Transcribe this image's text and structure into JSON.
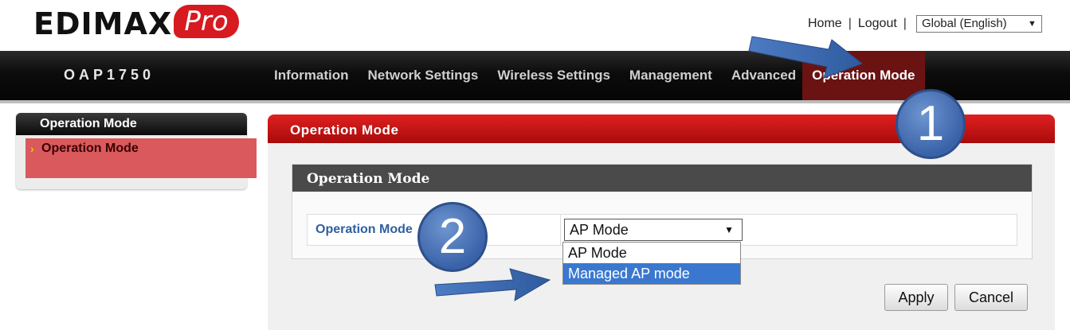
{
  "header": {
    "logo_text": "EDIMAX",
    "logo_pro": "Pro",
    "links": {
      "home": "Home",
      "separator": "|",
      "logout": "Logout"
    },
    "language": "Global (English)",
    "language_caret": "▼"
  },
  "navbar": {
    "model": "OAP1750",
    "items": [
      {
        "label": "Information"
      },
      {
        "label": "Network Settings"
      },
      {
        "label": "Wireless Settings"
      },
      {
        "label": "Management"
      },
      {
        "label": "Advanced"
      },
      {
        "label": "Operation Mode",
        "active": true
      }
    ]
  },
  "sidebar": {
    "title": "Operation Mode",
    "items": [
      {
        "label": "Operation Mode",
        "marker": "›"
      }
    ]
  },
  "main": {
    "title": "Operation Mode",
    "card_title": "Operation Mode",
    "field_label": "Operation Mode",
    "select_value": "AP Mode",
    "select_caret": "▼",
    "options": [
      "AP Mode",
      "Managed AP mode"
    ],
    "highlighted_option": 1,
    "apply_label": "Apply",
    "cancel_label": "Cancel"
  },
  "annotations": {
    "step_1": "1",
    "step_2": "2",
    "color": "#3a62a8"
  },
  "colors": {
    "brand_red": "#d71920",
    "panel_red": "#c81414",
    "nav_active": "#6b1212",
    "option_highlight": "#3a78d0"
  }
}
